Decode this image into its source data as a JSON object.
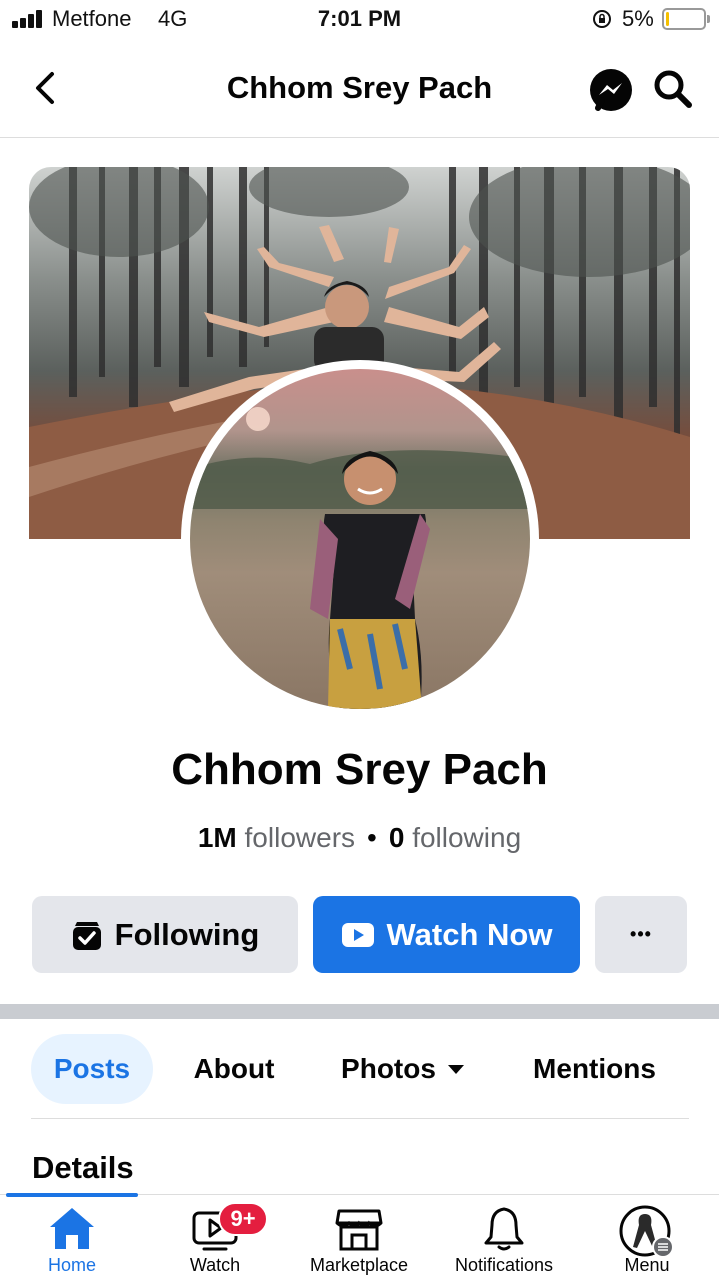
{
  "status_bar": {
    "carrier": "Metfone",
    "network": "4G",
    "time": "7:01 PM",
    "battery_percent": "5%",
    "battery_level": 0.05,
    "signal_icon": "signal-bars-icon",
    "orientation_lock_icon": "orientation-lock-icon"
  },
  "header": {
    "title": "Chhom Srey Pach",
    "back_icon": "chevron-left-icon",
    "messenger_icon": "messenger-icon",
    "search_icon": "search-icon"
  },
  "profile": {
    "name": "Chhom Srey Pach",
    "followers_count": "1M",
    "followers_label": "followers",
    "following_count": "0",
    "following_label": "following",
    "separator": "•"
  },
  "actions": {
    "following_label": "Following",
    "watch_label": "Watch Now",
    "more_label": "•••",
    "accent_color": "#1b74e4"
  },
  "tabs": [
    {
      "label": "Posts",
      "active": true
    },
    {
      "label": "About",
      "active": false
    },
    {
      "label": "Photos",
      "active": false
    },
    {
      "label": "Mentions",
      "active": false
    }
  ],
  "section": {
    "heading": "Details"
  },
  "bottom_nav": {
    "items": [
      {
        "label": "Home",
        "icon": "home-icon",
        "active": true
      },
      {
        "label": "Watch",
        "icon": "watch-icon",
        "active": false,
        "badge": "9+"
      },
      {
        "label": "Marketplace",
        "icon": "marketplace-icon",
        "active": false
      },
      {
        "label": "Notifications",
        "icon": "bell-icon",
        "active": false
      },
      {
        "label": "Menu",
        "icon": "menu-avatar-icon",
        "active": false
      }
    ],
    "badge_color": "#e41e3f"
  }
}
